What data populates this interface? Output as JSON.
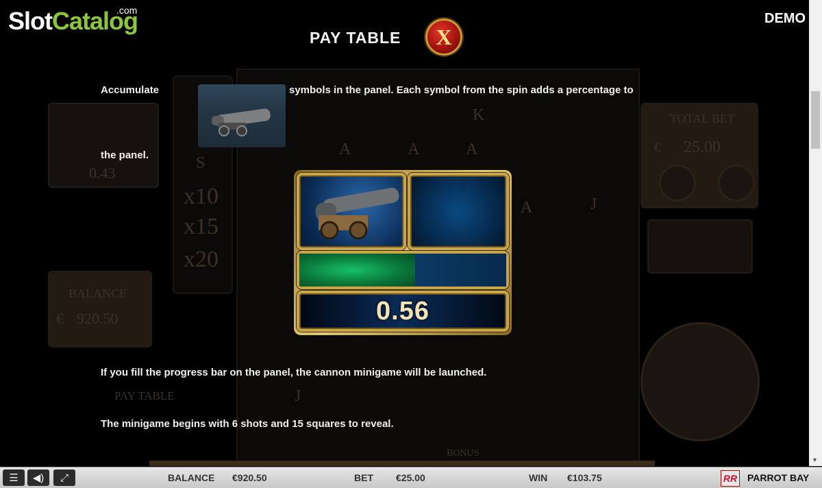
{
  "site": {
    "logo_slot": "Slot",
    "logo_catalog": "Catalog",
    "logo_com": ".com",
    "demo_label": "DEMO"
  },
  "paytable": {
    "title": "PAY TABLE",
    "close_symbol": "X",
    "text_accumulate": "Accumulate",
    "text_symbols": "symbols in the panel. Each symbol from the spin adds a percentage to",
    "text_the_panel": "the panel.",
    "panel_value": "0.56",
    "panel_progress_fraction": 0.56,
    "text_fill": "If you fill the progress bar on the panel, the cannon minigame will be launched.",
    "text_minigame": "The minigame begins with 6 shots and 15 squares to reveal."
  },
  "backdrop": {
    "left_value": "0.43",
    "multipliers": [
      "x10",
      "x15",
      "x20"
    ],
    "balance_label": "BALANCE",
    "balance_value": "920.50",
    "currency": "€",
    "total_bet_label": "TOTAL BET",
    "total_bet_value": "25.00",
    "paytable_label": "PAY TABLE",
    "bonus_label": "BONUS",
    "reel_letters": [
      "S",
      "A",
      "A",
      "K",
      "A",
      "J",
      "A",
      "J"
    ]
  },
  "bottombar": {
    "balance_label": "BALANCE",
    "balance_value": "€920.50",
    "bet_label": "BET",
    "bet_value": "€25.00",
    "win_label": "WIN",
    "win_value": "€103.75",
    "brand_mark": "RR",
    "game_name": "PARROT BAY"
  },
  "colors": {
    "logo_green": "#8cc63f",
    "frame_gold": "#c9a64a",
    "bar_green": "#18c06a",
    "close_red": "#c0201a"
  }
}
